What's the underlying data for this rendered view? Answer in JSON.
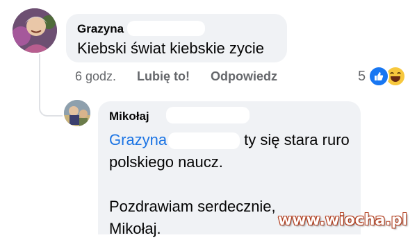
{
  "comment": {
    "author": "Grazyna",
    "text": "Kiebski świat kiebskie zycie",
    "time": "6 godz.",
    "like_label": "Lubię to!",
    "reply_label": "Odpowiedz",
    "reaction_count": "5",
    "reactions": [
      "like-icon",
      "haha-icon"
    ]
  },
  "reply": {
    "author": "Mikołaj",
    "mention": "Grazyna",
    "text_line1": "ty się stara ruro",
    "text_line2": "polskiego naucz.",
    "text_line3": "Pozdrawiam serdecznie,",
    "text_line4": "Mikołaj."
  },
  "watermark": "www.wiocha.pl",
  "colors": {
    "bubble": "#f0f2f5",
    "mention": "#1b74e4",
    "meta": "#65676b",
    "like": "#1877f2",
    "haha": "#f7c83d"
  }
}
